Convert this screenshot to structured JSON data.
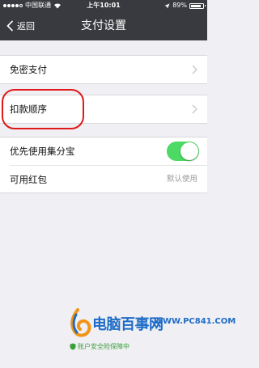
{
  "status_bar": {
    "carrier": "中国联通",
    "time": "上午10:01",
    "battery": "89%"
  },
  "nav": {
    "back_label": "返回",
    "title": "支付设置"
  },
  "settings": {
    "password_free": {
      "label": "免密支付"
    },
    "deduction_order": {
      "label": "扣款顺序"
    },
    "jifenbao": {
      "label": "优先使用集分宝",
      "enabled": true
    },
    "red_packet": {
      "label": "可用红包",
      "value": "默认使用"
    }
  },
  "watermark": {
    "name": "电脑百事网",
    "url": "WWW.PC841.COM",
    "slogan": "账户安全险保障中"
  },
  "colors": {
    "navbar": "#393a3f",
    "toggle_on": "#4cd964",
    "highlight": "#e01818",
    "watermark_blue": "#1e6cc7"
  }
}
